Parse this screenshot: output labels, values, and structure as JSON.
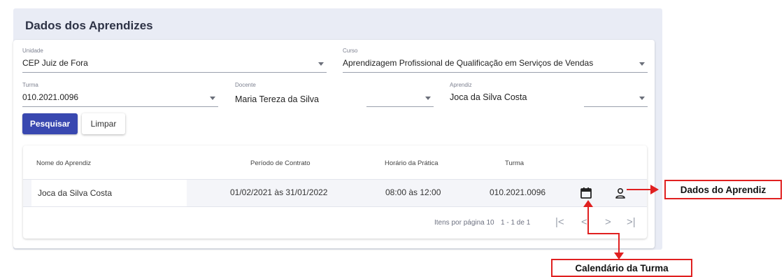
{
  "panel": {
    "title": "Dados dos Aprendizes"
  },
  "filters": {
    "unidade": {
      "label": "Unidade",
      "value": "CEP Juiz de Fora"
    },
    "curso": {
      "label": "Curso",
      "value": "Aprendizagem Profissional de Qualificação em Serviços de Vendas"
    },
    "turma": {
      "label": "Turma",
      "value": "010.2021.0096"
    },
    "docente": {
      "label": "Docente",
      "value": "Maria Tereza da Silva"
    },
    "aprendiz": {
      "label": "Aprendiz",
      "value": "Joca da Silva Costa"
    }
  },
  "buttons": {
    "search": "Pesquisar",
    "clear": "Limpar"
  },
  "table": {
    "columns": [
      "Nome do Aprendiz",
      "Período de Contrato",
      "Horário da Prática",
      "Turma"
    ],
    "rows": [
      {
        "nome": "Joca da Silva Costa",
        "periodo": "01/02/2021 às 31/01/2022",
        "horario": "08:00 às 12:00",
        "turma": "010.2021.0096"
      }
    ],
    "row_icons": [
      "calendar-icon",
      "person-icon"
    ]
  },
  "pagination": {
    "items_per_page_label": "Itens por página",
    "items_per_page": "10",
    "range": "1 - 1 de 1",
    "first": "|<",
    "prev": "<",
    "next": ">",
    "last": ">|"
  },
  "annotations": {
    "aprendiz": "Dados do Aprendiz",
    "calendario": "Calendário da Turma",
    "color": "#e02020"
  },
  "colors": {
    "primary": "#3948b0",
    "panel_bg": "#e9ecf5"
  }
}
